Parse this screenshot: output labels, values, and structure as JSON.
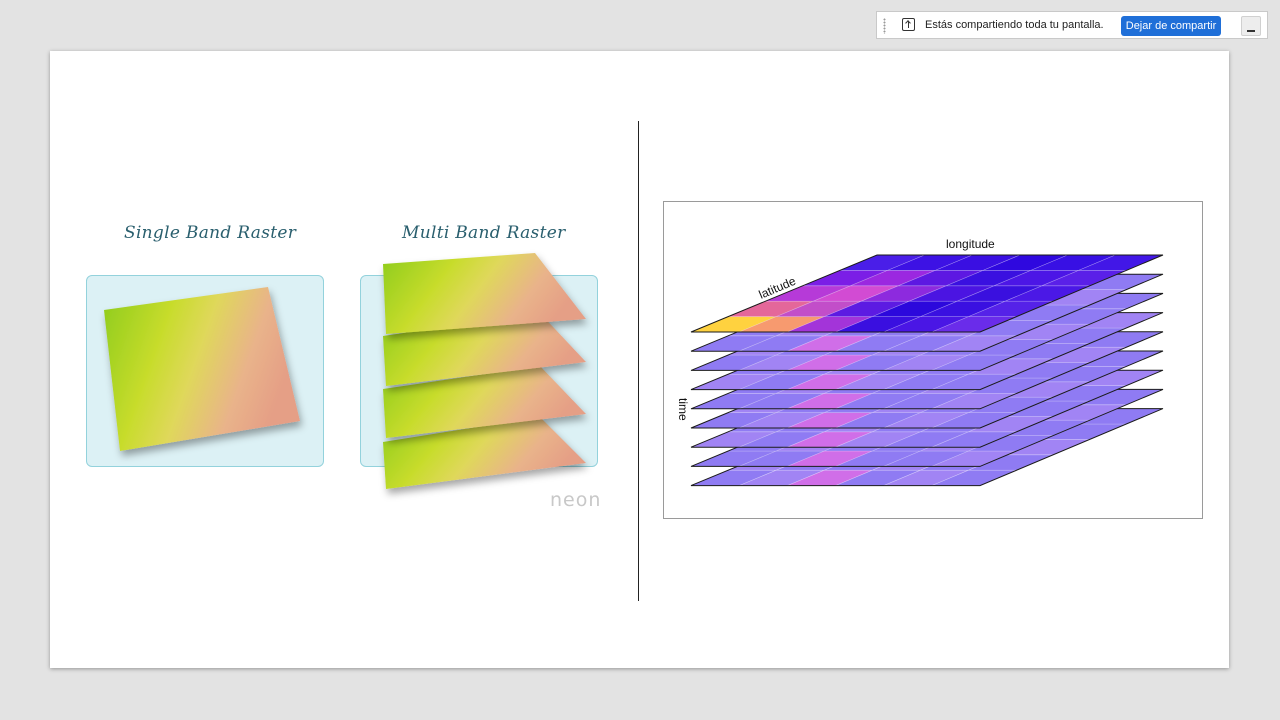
{
  "share_bar": {
    "message": "Estás compartiendo toda tu pantalla.",
    "stop_label": "Dejar de compartir",
    "share_icon": "share-screen-icon",
    "minimize_icon": "minimize-icon"
  },
  "slide": {
    "single_title": "Single Band Raster",
    "multi_title": "Multi Band Raster",
    "logo": "neon",
    "cube": {
      "label_longitude": "longitude",
      "label_latitude": "latitude",
      "label_time": "time"
    }
  },
  "colors": {
    "share_button": "#1f6fd8",
    "raster_green": "#7cc51e",
    "raster_salmon": "#e8a38a",
    "cube_base": "#8f7bf3",
    "cube_top_blue": "#3412e6"
  }
}
